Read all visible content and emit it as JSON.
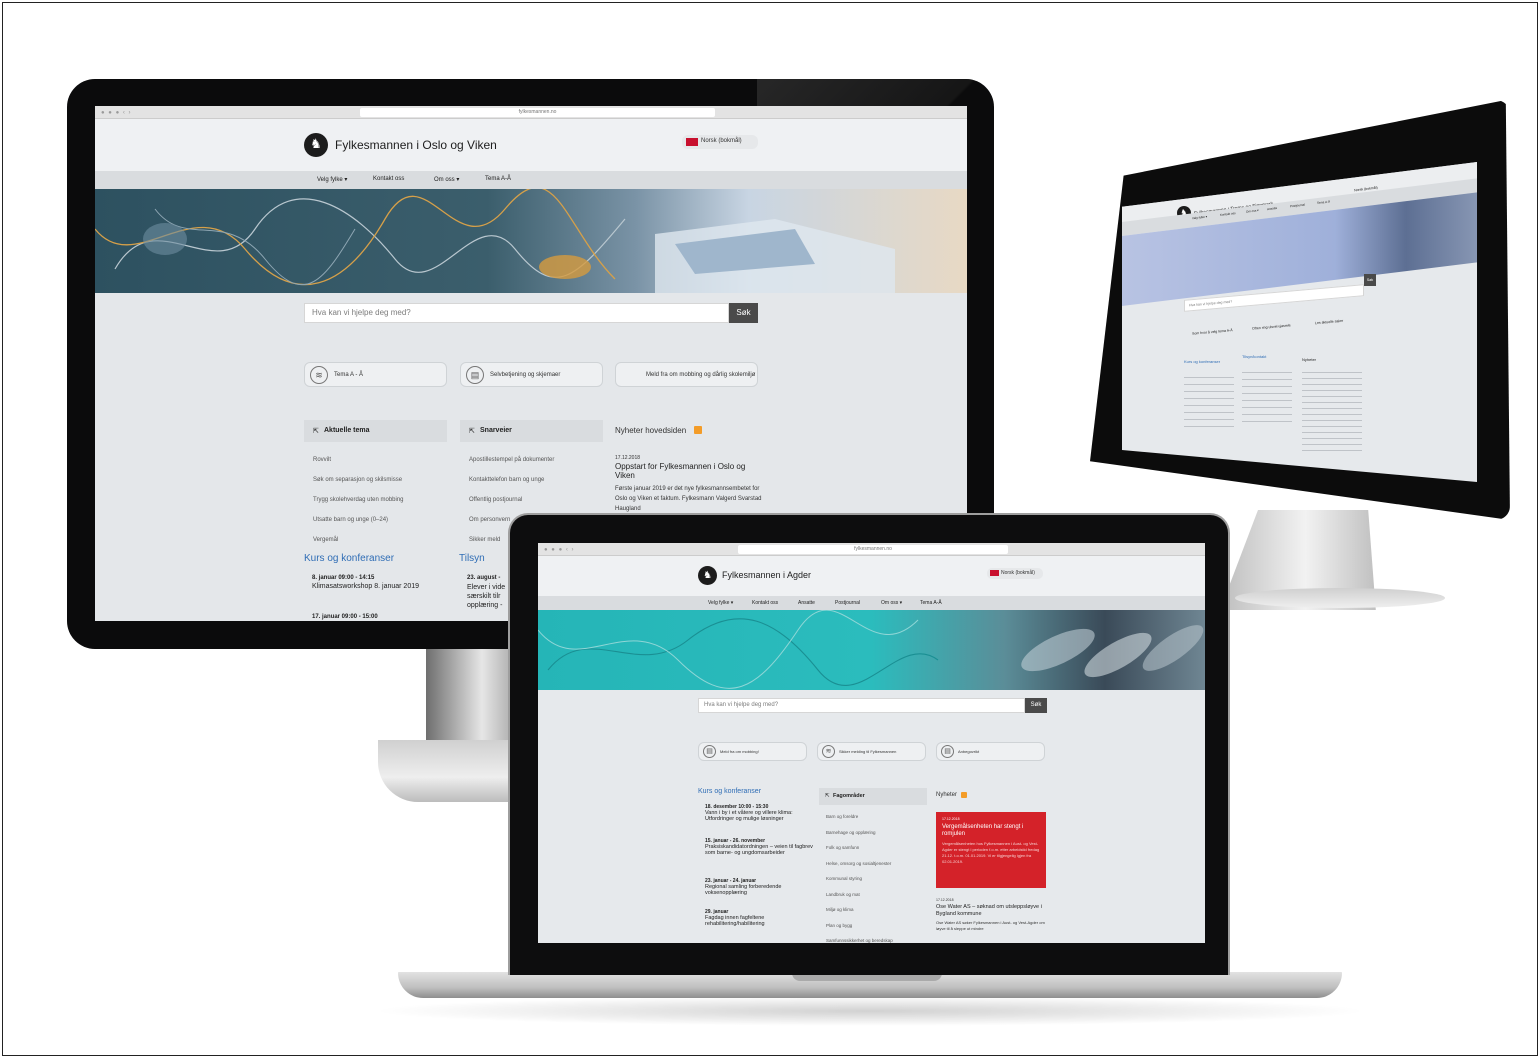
{
  "a": {
    "url": "fylkesmannen.no",
    "title": "Fylkesmannen i Oslo og Viken",
    "lang": "Norsk (bokmål)",
    "nav": [
      "Velg fylke ▾",
      "Kontakt oss",
      "Om oss ▾",
      "Tema A-Å"
    ],
    "search_placeholder": "Hva kan vi hjelpe deg med?",
    "search_btn": "Søk",
    "quick": [
      "Tema A - Å",
      "Selvbetjening og skjemaer",
      "Meld fra om mobbing og dårlig skolemiljø"
    ],
    "aktuelle": {
      "title": "Aktuelle tema",
      "items": [
        "Rovvilt",
        "Søk om separasjon og skilsmisse",
        "Trygg skolehverdag uten mobbing",
        "Utsatte barn og unge (0–24)",
        "Vergemål"
      ]
    },
    "snarveier": {
      "title": "Snarveier",
      "items": [
        "Apostillestempel på dokumenter",
        "Kontakttelefon barn og unge",
        "Offentlig postjournal",
        "Om personvern",
        "Sikker meld"
      ]
    },
    "nyheter": {
      "title": "Nyheter hovedsiden",
      "date": "17.12.2018",
      "headline": "Oppstart for Fylkesmannen i Oslo og Viken",
      "body": "Første januar 2019 er det nye fylkesmannsembetet for Oslo og Viken et faktum. Fylkesmann Valgerd Svarstad Haugland"
    },
    "kurs": {
      "title": "Kurs og konferanser",
      "items": [
        {
          "date": "8. januar 09:00 - 14:15",
          "text": "Klimasatsworkshop 8. januar 2019"
        },
        {
          "date": "17. januar 09:00 - 15:00",
          "text": ""
        }
      ]
    },
    "tilsyn": {
      "title": "Tilsyn",
      "date": "23. august -",
      "text": "Elever i vide særskilt tilr opplæring -"
    }
  },
  "b": {
    "url": "fylkesmannen.no",
    "title": "Fylkesmannen i Agder",
    "lang": "Norsk (bokmål)",
    "nav": [
      "Velg fylke ▾",
      "Kontakt oss",
      "Ansatte",
      "Postjournal",
      "Om oss ▾",
      "Tema A-Å"
    ],
    "search_placeholder": "Hva kan vi hjelpe deg med?",
    "search_btn": "Søk",
    "quick": [
      "Meld fra om mobbing!",
      "Sikker melding til Fylkesmannen",
      "Anbegovrikt"
    ],
    "kurs": {
      "title": "Kurs og konferanser",
      "items": [
        {
          "date": "18. desember 10:00 - 15:30",
          "text": "Vann i by i et våtere og villere klima: Utfordringer og mulige løsninger"
        },
        {
          "date": "15. januar - 26. november",
          "text": "Praksiskandidatordningen – veien til fagbrev som barne- og ungdomsarbeider"
        },
        {
          "date": "23. januar - 24. januar",
          "text": "Regional samling forberedende voksenopplæring"
        },
        {
          "date": "29. januar",
          "text": "Fagdag innen fagfeltene rehabilitering/habilitering"
        }
      ]
    },
    "fag": {
      "title": "Fagområder",
      "items": [
        "Barn og foreldre",
        "Barnehage og opplæring",
        "Folk og samfunn",
        "Helse, omsorg og sosialtjenester",
        "Kommunal styring",
        "Landbruk og mat",
        "Miljø og klima",
        "Plan og bygg",
        "Samfunnssikkerhet og beredskap"
      ]
    },
    "nyheter": {
      "title": "Nyheter",
      "alert_date": "17.12.2018",
      "alert_title": "Vergemålsenheten har stengt i romjulen",
      "alert_body": "Vergemålsenheten hos Fylkesmannen i Aust- og Vest-Agder er stengt i perioden f.o.m. etter arbeidstid fredag 21.12. t.o.m. 01.01.2019. Vi er tilgjengelig igjen fra 02.01.2019.",
      "date2": "17.12.2018",
      "headline2": "Ose Water AS – søknad om utsleppsløyve i Bygland kommune",
      "body2": "Ose Water AS søker Fylkesmannen i Aust- og Vest-Agder om løyve til å sleppe ut mindre"
    }
  },
  "c": {
    "title": "Fylkesmannen i Troms og Finnmark",
    "lang": "Norsk (bokmål)",
    "nav": [
      "Velg fylke ▾",
      "Kontakt oss",
      "Om oss ▾",
      "Ansatte",
      "Postjournal",
      "Tema A-Å"
    ],
    "search_placeholder": "Hva kan vi hjelpe deg med?",
    "search_btn": "Søk",
    "quick": [
      "Som hvor å velg tema A-Å",
      "Ofren ring ulsvel ujasrele",
      "Les aktuelle saker"
    ],
    "kurs": "Kurs og konferanser",
    "tilsyn": "Tilsyn/kontakt",
    "nyheter": "Nyheter"
  }
}
